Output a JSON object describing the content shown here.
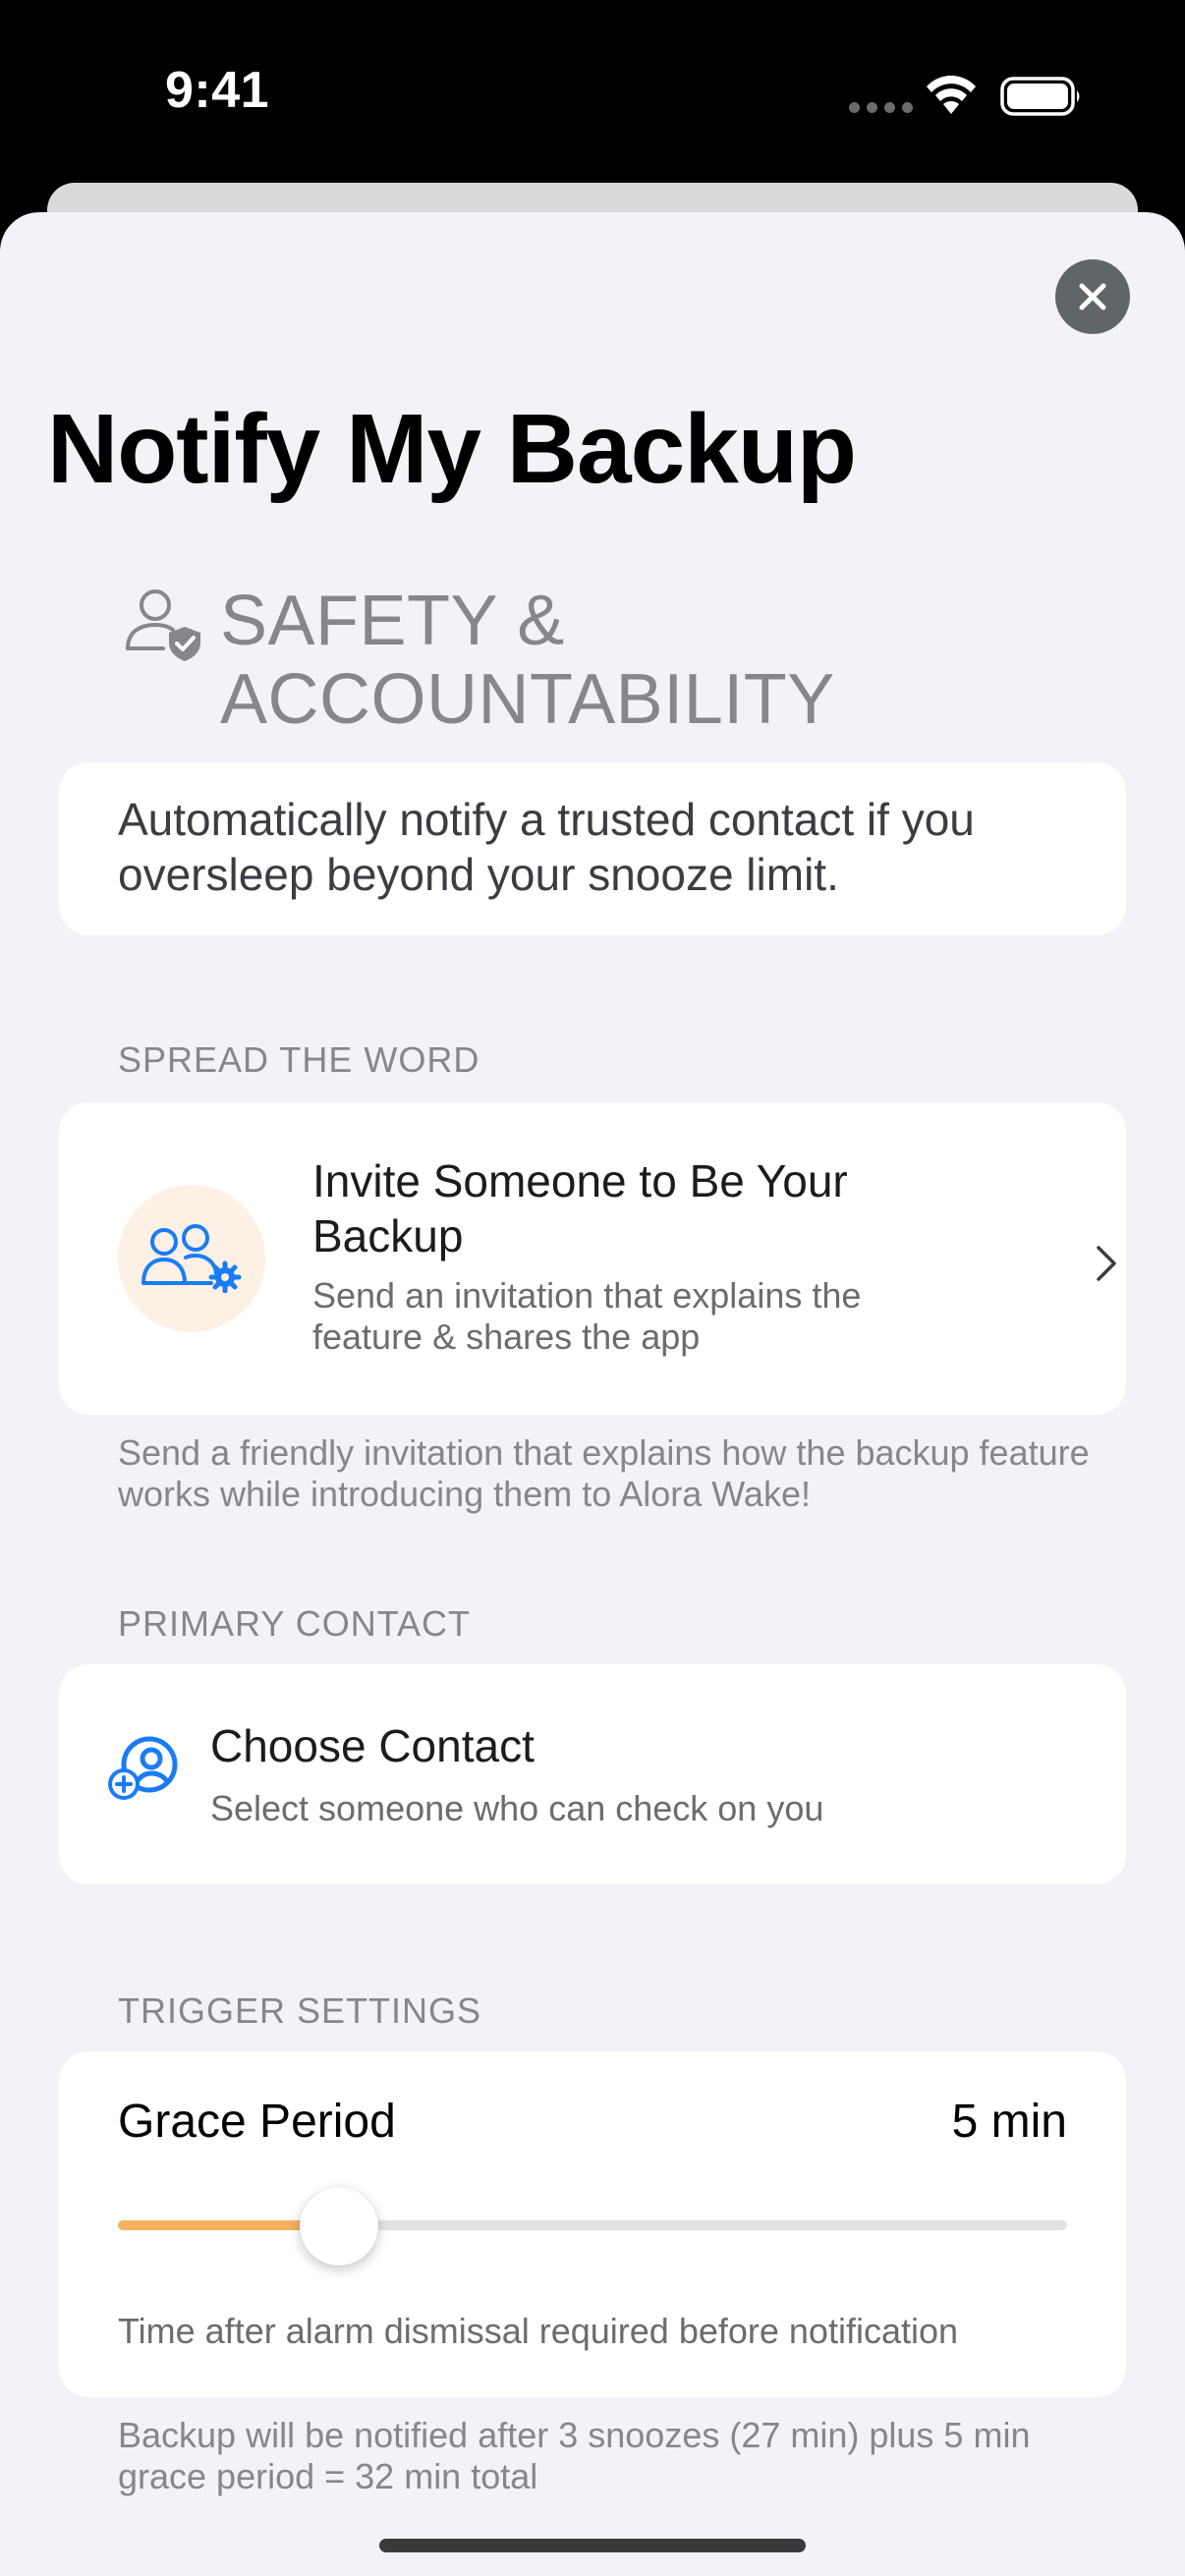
{
  "status": {
    "time": "9:41"
  },
  "page": {
    "title": "Notify My Backup"
  },
  "safety": {
    "header": "SAFETY & ACCOUNTABILITY",
    "description": "Automatically notify a trusted contact if you oversleep beyond your snooze limit."
  },
  "spread": {
    "label": "SPREAD THE WORD",
    "invite_title": "Invite Someone to Be Your Backup",
    "invite_subtitle": "Send an invitation that explains the feature & shares the app",
    "footnote": "Send a friendly invitation that explains how the backup feature works while introducing them to Alora Wake!"
  },
  "primary": {
    "label": "PRIMARY CONTACT",
    "choose_title": "Choose Contact",
    "choose_subtitle": "Select someone who can check on you"
  },
  "trigger": {
    "label": "TRIGGER SETTINGS",
    "grace_label": "Grace Period",
    "grace_value": "5 min",
    "slider_fraction": 0.233,
    "grace_description": "Time after alarm dismissal required before notification",
    "footnote": "Backup will be notified after 3 snoozes (27 min) plus 5 min grace period = 32 min total"
  },
  "colors": {
    "accent_blue": "#1a7cf5",
    "slider_fill": "#f5b15f",
    "background": "#f2f2f7",
    "secondary_text": "#86868b"
  },
  "icons": [
    "close-icon",
    "person-shield-icon",
    "people-gear-icon",
    "chevron-right-icon",
    "person-add-icon",
    "wifi-icon",
    "battery-icon"
  ]
}
